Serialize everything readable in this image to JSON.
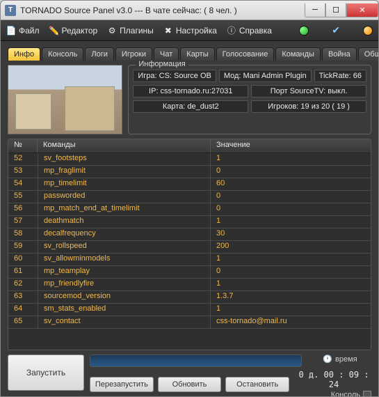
{
  "window": {
    "title": "TORNADO Source Panel v3.0 --- В чате сейчас: ( 8 чел. )",
    "favicon_letter": "T"
  },
  "menu": {
    "file": "Файл",
    "editor": "Редактор",
    "plugins": "Плагины",
    "settings": "Настройка",
    "help": "Справка"
  },
  "tabs": [
    "Инфо",
    "Консоль",
    "Логи",
    "Игроки",
    "Чат",
    "Карты",
    "Голосование",
    "Команды",
    "Война",
    "Общение"
  ],
  "active_tab": 0,
  "info_box": {
    "legend": "Информация",
    "game": "Игра: CS: Source OB",
    "mod": "Мод: Mani Admin Plugin",
    "tickrate": "TickRate: 66",
    "ip": "IP: css-tornado.ru:27031",
    "sourcetv": "Порт SourceTV:  выкл.",
    "map": "Карта: de_dust2",
    "players": "Игроков: 19 из 20  ( 19 )"
  },
  "table": {
    "headers": {
      "num": "№",
      "cmd": "Команды",
      "val": "Значение"
    },
    "rows": [
      {
        "n": "52",
        "cmd": "sv_footsteps",
        "val": "1"
      },
      {
        "n": "53",
        "cmd": "mp_fraglimit",
        "val": "0"
      },
      {
        "n": "54",
        "cmd": "mp_timelimit",
        "val": "60"
      },
      {
        "n": "55",
        "cmd": "passworded",
        "val": "0"
      },
      {
        "n": "56",
        "cmd": "mp_match_end_at_timelimit",
        "val": "0"
      },
      {
        "n": "57",
        "cmd": "deathmatch",
        "val": "1"
      },
      {
        "n": "58",
        "cmd": "decalfrequency",
        "val": "30"
      },
      {
        "n": "59",
        "cmd": "sv_rollspeed",
        "val": "200"
      },
      {
        "n": "60",
        "cmd": "sv_allowminmodels",
        "val": "1"
      },
      {
        "n": "61",
        "cmd": "mp_teamplay",
        "val": "0"
      },
      {
        "n": "62",
        "cmd": "mp_friendlyfire",
        "val": "1"
      },
      {
        "n": "63",
        "cmd": "sourcemod_version",
        "val": "1.3.7"
      },
      {
        "n": "64",
        "cmd": "sm_stats_enabled",
        "val": "1"
      },
      {
        "n": "65",
        "cmd": "sv_contact",
        "val": "css-tornado@mail.ru"
      }
    ]
  },
  "footer": {
    "run": "Запустить",
    "restart": "Перезапустить",
    "refresh": "Обновить",
    "stop": "Остановить",
    "time_label": "время",
    "time_value": "0 д.  00 : 09 : 24",
    "console": "Консоль"
  }
}
